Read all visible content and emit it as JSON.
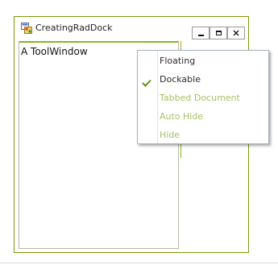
{
  "window": {
    "title": "CreatingRadDock",
    "accent_color": "#7a9a08",
    "controls": [
      {
        "name": "minimize",
        "icon": "minimize-icon"
      },
      {
        "name": "maximize",
        "icon": "maximize-icon"
      },
      {
        "name": "close",
        "icon": "close-icon"
      }
    ]
  },
  "tool_window": {
    "title": "A ToolWindow",
    "accent_color": "#8ab81a"
  },
  "context_menu": {
    "items": [
      {
        "label": "Floating",
        "enabled": true,
        "checked": false
      },
      {
        "label": "Dockable",
        "enabled": true,
        "checked": true
      },
      {
        "label": "Tabbed Document",
        "enabled": false,
        "checked": false
      },
      {
        "label": "Auto Hide",
        "enabled": false,
        "checked": false
      },
      {
        "label": "Hide",
        "enabled": false,
        "checked": false
      }
    ],
    "check_color": "#6a8f12",
    "disabled_text_color": "#a7c065"
  }
}
